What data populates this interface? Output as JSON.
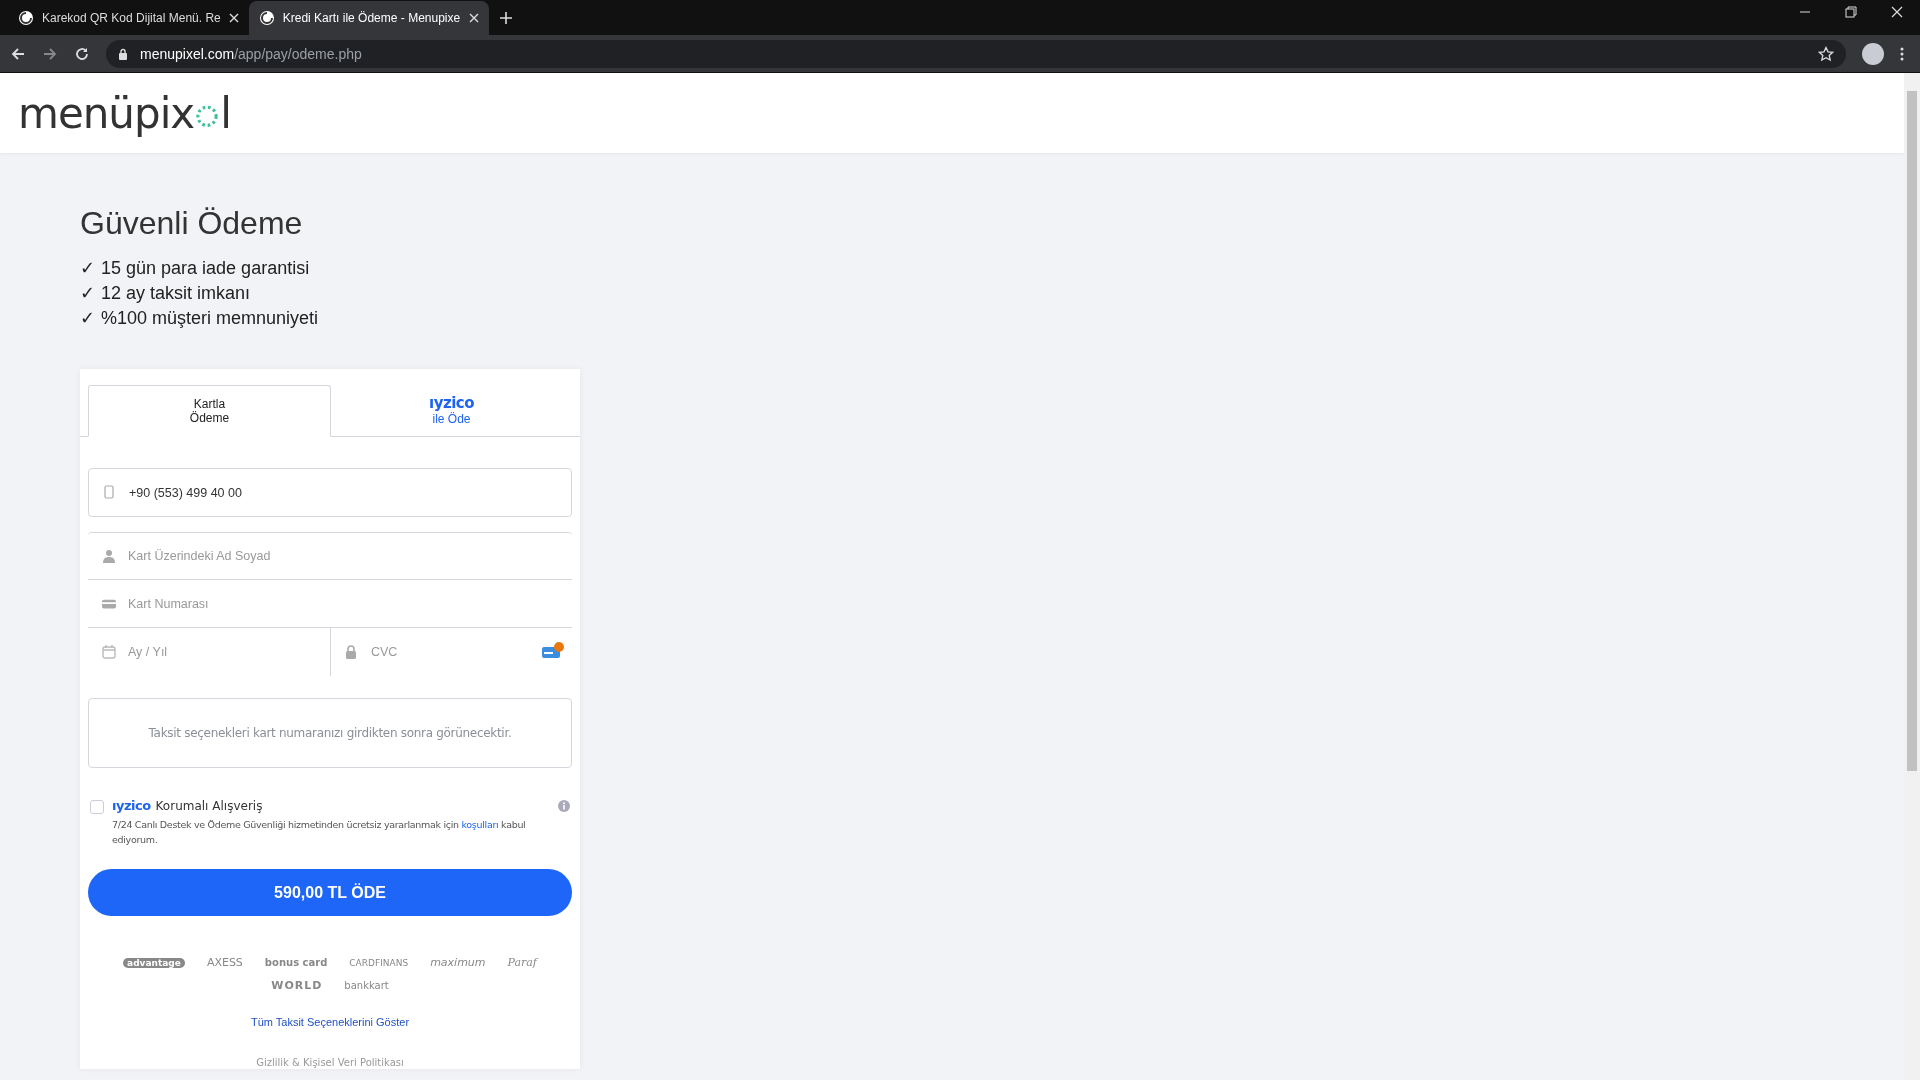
{
  "browser": {
    "tabs": [
      {
        "title": "Karekod QR Kod Dijital Menü. Re",
        "selected": false
      },
      {
        "title": "Kredi Kartı ile Ödeme - Menupixe",
        "selected": true
      }
    ],
    "url_host": "menupixel.com",
    "url_path": "/app/pay/odeme.php"
  },
  "logo": {
    "text": "menüpix",
    "tail": "l"
  },
  "heading": "Güvenli Ödeme",
  "benefits": [
    {
      "mark": "✓",
      "text": "15 gün para iade garantisi"
    },
    {
      "mark": "✓",
      "text": "12 ay taksit imkanı"
    },
    {
      "mark": "✓",
      "text": "%100 müşteri memnuniyeti"
    }
  ],
  "payment_tabs": [
    {
      "kind": "text",
      "lines": [
        "Kartla",
        "Ödeme"
      ],
      "selected": true
    },
    {
      "kind": "brand",
      "lines": [
        "ıyzico",
        "ile Öde"
      ],
      "selected": false
    }
  ],
  "phone": {
    "value": "+90 (553) 499 40 00"
  },
  "card_fields": {
    "name": {
      "placeholder": "Kart Üzerindeki Ad Soyad"
    },
    "number": {
      "placeholder": "Kart Numarası"
    },
    "expiry": {
      "placeholder": "Ay / Yıl"
    },
    "cvc": {
      "placeholder": "CVC"
    }
  },
  "installments_note": "Taksit seçenekleri kart numaranızı girdikten sonra görünecektir.",
  "protection": {
    "checked": false,
    "brand": "ıyzico",
    "label": "Korumalı Alışveriş",
    "terms_before": "7/24 Canlı Destek ve Ödeme Güvenliği hizmetinden ücretsiz yararlanmak için",
    "terms_link": "koşulları",
    "terms_after": "kabul ediyorum."
  },
  "pay_button": "590,00 TL ÖDE",
  "bank_logos": [
    "advantage",
    "AXESS",
    "bonus card",
    "CARDFINANS",
    "maximum",
    "Paraf",
    "WORLD",
    "bankkart"
  ],
  "installments_link": "Tüm Taksit Seçeneklerini Göster",
  "privacy_link": "Gizlilik & Kişisel Veri Politikası"
}
